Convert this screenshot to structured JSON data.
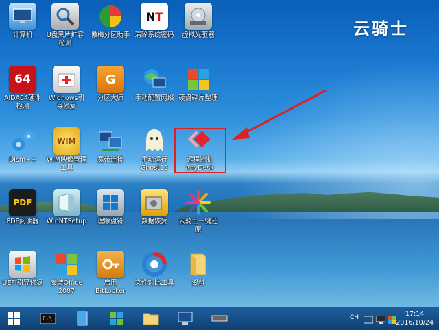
{
  "brand": {
    "title": "云骑士"
  },
  "desktop_icons": [
    {
      "label": "计算机"
    },
    {
      "label": "U盘黑片扩容\n检测"
    },
    {
      "label": "傲梅分区助手"
    },
    {
      "label": "清除系统密码"
    },
    {
      "label": "虚拟光驱器"
    },
    {
      "label": "AIDA64硬件\n检测",
      "badge": "64"
    },
    {
      "label": "Widnows引\n导修复"
    },
    {
      "label": "分区大师"
    },
    {
      "label": "手动配置网络"
    },
    {
      "label": "硬盘碎片整理"
    },
    {
      "label": "Dism++"
    },
    {
      "label": "WIM映像管理\n工具",
      "badge": "WIM"
    },
    {
      "label": "宽带连接"
    },
    {
      "label": "手动运行\nGhost12"
    },
    {
      "label": "远程控制\nAnyDesk"
    },
    {
      "label": "PDF阅读器",
      "badge": "PDF"
    },
    {
      "label": "WinNTSetup"
    },
    {
      "label": "理顺盘符"
    },
    {
      "label": "数据恢复"
    },
    {
      "label": "云骑士一键还\n原"
    },
    {
      "label": "UEFI引导修复"
    },
    {
      "label": "安装Office\n2007"
    },
    {
      "label": "启用\nBitLocker"
    },
    {
      "label": "文件对比工具"
    },
    {
      "label": "资料"
    }
  ],
  "taskbar": {
    "tray_ime": "CH",
    "clock_time": "17:14",
    "clock_date": "2016/10/24"
  },
  "colors": {
    "highlight": "#e02020",
    "anydesk": "#e8232a"
  }
}
